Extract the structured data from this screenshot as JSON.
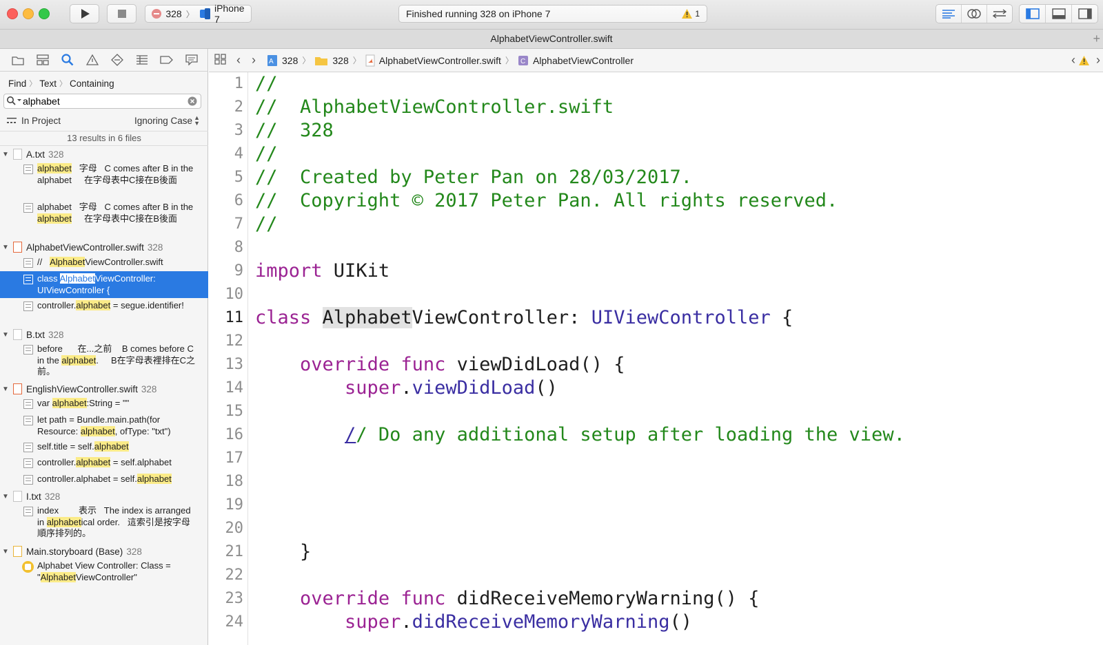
{
  "toolbar": {
    "scheme_name": "328",
    "device": "iPhone 7",
    "status_text": "Finished running 328 on iPhone 7",
    "warning_count": "1"
  },
  "tab": {
    "title": "AlphabetViewController.swift"
  },
  "navigator": {
    "find_path": [
      "Find",
      "Text",
      "Containing"
    ],
    "search_value": "alphabet",
    "scope": "In Project",
    "case_mode": "Ignoring Case",
    "summary": "13 results in 6 files",
    "files": [
      {
        "name": "A.txt",
        "project": "328"
      },
      {
        "name": "AlphabetViewController.swift",
        "project": "328"
      },
      {
        "name": "B.txt",
        "project": "328"
      },
      {
        "name": "EnglishViewController.swift",
        "project": "328"
      },
      {
        "name": "I.txt",
        "project": "328"
      },
      {
        "name": "Main.storyboard (Base)",
        "project": "328"
      }
    ]
  },
  "jumpbar": {
    "items": [
      "328",
      "328",
      "AlphabetViewController.swift",
      "AlphabetViewController"
    ]
  },
  "editor": {
    "line_numbers": [
      "1",
      "2",
      "3",
      "4",
      "5",
      "6",
      "7",
      "8",
      "9",
      "10",
      "11",
      "12",
      "13",
      "14",
      "15",
      "16",
      "17",
      "18",
      "19",
      "20",
      "21",
      "22",
      "23",
      "24"
    ],
    "current_line": "11"
  }
}
